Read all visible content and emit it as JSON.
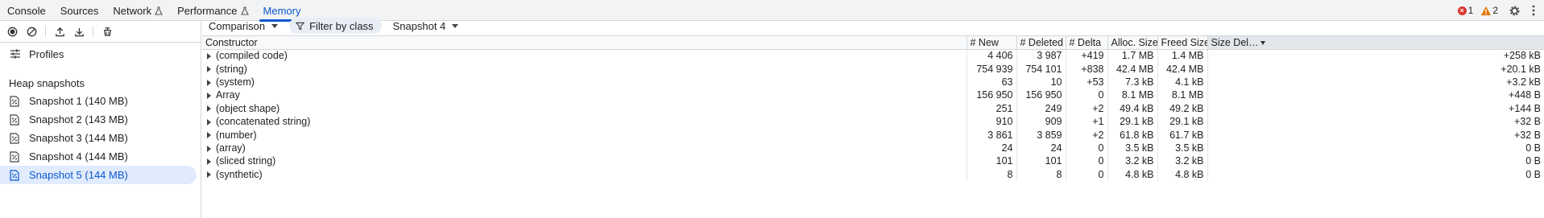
{
  "tabs": [
    {
      "label": "Console",
      "flask": false,
      "active": false
    },
    {
      "label": "Sources",
      "flask": false,
      "active": false
    },
    {
      "label": "Network",
      "flask": true,
      "active": false
    },
    {
      "label": "Performance",
      "flask": true,
      "active": false
    },
    {
      "label": "Memory",
      "flask": false,
      "active": true
    }
  ],
  "status": {
    "errors": "1",
    "warnings": "2"
  },
  "sidebar": {
    "profiles_label": "Profiles",
    "section_title": "Heap snapshots",
    "snapshots": [
      {
        "label": "Snapshot 1 (140 MB)",
        "selected": false
      },
      {
        "label": "Snapshot 2 (143 MB)",
        "selected": false
      },
      {
        "label": "Snapshot 3 (144 MB)",
        "selected": false
      },
      {
        "label": "Snapshot 4 (144 MB)",
        "selected": false
      },
      {
        "label": "Snapshot 5 (144 MB)",
        "selected": true
      }
    ]
  },
  "toolbar": {
    "view_mode": "Comparison",
    "filter_label": "Filter by class",
    "base_snapshot": "Snapshot 4"
  },
  "table": {
    "columns": [
      "Constructor",
      "# New",
      "# Deleted",
      "# Delta",
      "Alloc. Size",
      "Freed Size",
      "Size Del…"
    ],
    "sorted_column": "Size Del…",
    "rows": [
      [
        "(compiled code)",
        "4 406",
        "3 987",
        "+419",
        "1.7 MB",
        "1.4 MB",
        "+258 kB"
      ],
      [
        "(string)",
        "754 939",
        "754 101",
        "+838",
        "42.4 MB",
        "42.4 MB",
        "+20.1 kB"
      ],
      [
        "(system)",
        "63",
        "10",
        "+53",
        "7.3 kB",
        "4.1 kB",
        "+3.2 kB"
      ],
      [
        "Array",
        "156 950",
        "156 950",
        "0",
        "8.1 MB",
        "8.1 MB",
        "+448 B"
      ],
      [
        "(object shape)",
        "251",
        "249",
        "+2",
        "49.4 kB",
        "49.2 kB",
        "+144 B"
      ],
      [
        "(concatenated string)",
        "910",
        "909",
        "+1",
        "29.1 kB",
        "29.1 kB",
        "+32 B"
      ],
      [
        "(number)",
        "3 861",
        "3 859",
        "+2",
        "61.8 kB",
        "61.7 kB",
        "+32 B"
      ],
      [
        "(array)",
        "24",
        "24",
        "0",
        "3.5 kB",
        "3.5 kB",
        "0 B"
      ],
      [
        "(sliced string)",
        "101",
        "101",
        "0",
        "3.2 kB",
        "3.2 kB",
        "0 B"
      ],
      [
        "(synthetic)",
        "8",
        "8",
        "0",
        "4.8 kB",
        "4.8 kB",
        "0 B"
      ]
    ]
  },
  "colors": {
    "accent": "#0b57d0",
    "selected_bg": "#e0ebfd",
    "error": "#dc362e",
    "warning": "#e37400"
  }
}
